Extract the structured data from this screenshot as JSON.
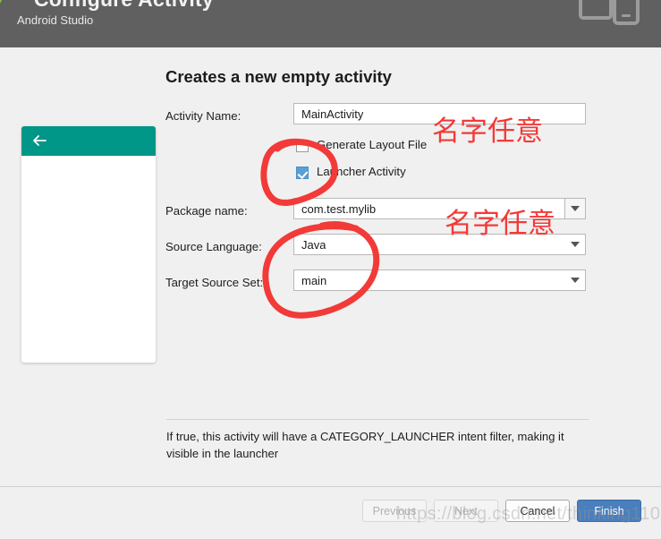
{
  "header": {
    "title": "Configure Activity",
    "subtitle": "Android Studio",
    "bg_color": "#606060",
    "logo_icon": "android-logo-icon",
    "device_icon": "tablet-and-phone-icon"
  },
  "step": {
    "title": "Creates a new empty activity"
  },
  "preview": {
    "appbar_color": "#009688",
    "back_icon": "arrow-left-icon"
  },
  "form": {
    "activity_name": {
      "label": "Activity Name:",
      "value": "MainActivity"
    },
    "generate_layout": {
      "label": "Generate Layout File",
      "checked": false
    },
    "launcher_activity": {
      "label": "Launcher Activity",
      "checked": true
    },
    "package_name": {
      "label": "Package name:",
      "value": "com.test.mylib"
    },
    "source_language": {
      "label": "Source Language:",
      "value": "Java"
    },
    "target_source_set": {
      "label": "Target Source Set:",
      "value": "main"
    }
  },
  "help": {
    "text": "If true, this activity will have a CATEGORY_LAUNCHER intent filter, making it visible in the launcher"
  },
  "footer": {
    "previous_label": "Previous",
    "next_label": "Next",
    "cancel_label": "Cancel",
    "finish_label": "Finish",
    "primary_color": "#4a7fbd"
  },
  "annotations": {
    "color": "#f23a38",
    "note_1": "名字任意",
    "note_2": "名字任意",
    "circle_1_target": "checkbox-group",
    "circle_2_target": "source-language-and-target-source-set"
  },
  "watermark": {
    "text": "https://blog.csdn.net/thinking110"
  }
}
